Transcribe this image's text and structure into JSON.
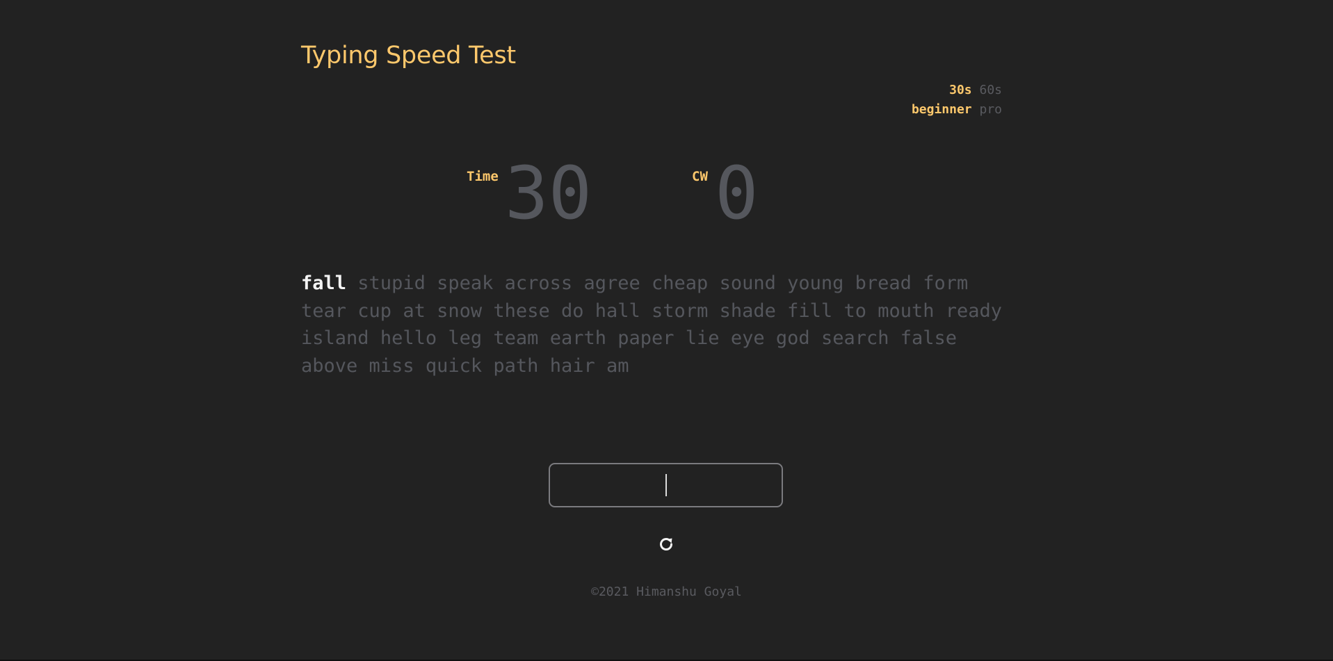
{
  "header": {
    "title": "Typing Speed Test"
  },
  "settings": {
    "time_options": [
      "30s",
      "60s"
    ],
    "time_selected": "30s",
    "level_options": [
      "beginner",
      "pro"
    ],
    "level_selected": "beginner"
  },
  "stats": {
    "time_label": "Time",
    "time_value": "30",
    "cw_label": "CW",
    "cw_value": "0"
  },
  "words": [
    "fall",
    "stupid",
    "speak",
    "across",
    "agree",
    "cheap",
    "sound",
    "young",
    "bread",
    "form",
    "tear",
    "cup",
    "at",
    "snow",
    "these",
    "do",
    "hall",
    "storm",
    "shade",
    "fill",
    "to",
    "mouth",
    "ready",
    "island",
    "hello",
    "leg",
    "team",
    "earth",
    "paper",
    "lie",
    "eye",
    "god",
    "search",
    "false",
    "above",
    "miss",
    "quick",
    "path",
    "hair",
    "am"
  ],
  "current_word_index": 0,
  "input": {
    "value": ""
  },
  "controls": {
    "reload_icon": "reload-icon"
  },
  "footer": {
    "text": "©2021 Himanshu Goyal"
  },
  "colors": {
    "background": "#222222",
    "accent": "#fdc86c",
    "muted": "#55575d",
    "current_word": "#f4f4f4"
  }
}
